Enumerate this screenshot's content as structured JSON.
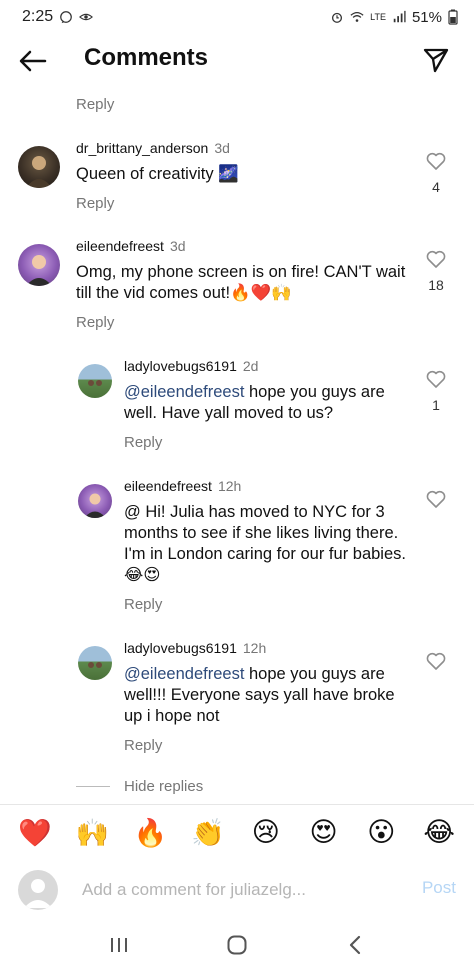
{
  "status_bar": {
    "time": "2:25",
    "battery": "51%",
    "network": "LTE"
  },
  "header": {
    "title": "Comments"
  },
  "top_reply_label": "Reply",
  "comments": [
    {
      "username": "dr_brittany_anderson",
      "time": "3d",
      "text": "Queen of creativity 🌌",
      "reply_label": "Reply",
      "likes": "4"
    },
    {
      "username": "eileendefreest",
      "time": "3d",
      "text": "Omg, my phone screen is on fire! CAN'T wait till the vid comes out!🔥❤️🙌",
      "reply_label": "Reply",
      "likes": "18"
    }
  ],
  "replies": [
    {
      "username": "ladylovebugs6191",
      "time": "2d",
      "mention": "@eileendefreest",
      "text": " hope you guys are well. Have yall moved to us?",
      "reply_label": "Reply",
      "likes": "1"
    },
    {
      "username": "eileendefreest",
      "time": "12h",
      "mention": "",
      "text": "@ Hi! Julia has moved to NYC for 3 months to see if she likes living there. I'm in London caring for our fur babies. 😂😍",
      "reply_label": "Reply",
      "likes": ""
    },
    {
      "username": "ladylovebugs6191",
      "time": "12h",
      "mention": "@eileendefreest",
      "text": " hope you guys are well!!! Everyone says yall have broke up i hope not",
      "reply_label": "Reply",
      "likes": ""
    }
  ],
  "hide_replies_label": "Hide replies",
  "emoji_bar": [
    "❤️",
    "🙌",
    "🔥",
    "👏",
    "😢",
    "😍",
    "😮",
    "😂"
  ],
  "comment_input": {
    "placeholder": "Add a comment for juliazelg...",
    "post_label": "Post"
  },
  "icons": {
    "back": "back-arrow-icon",
    "send": "send-icon",
    "like": "heart-outline-icon"
  },
  "colors": {
    "mention": "#2d4a7a",
    "secondary_text": "#767676",
    "post_disabled": "#b6d6f5"
  }
}
